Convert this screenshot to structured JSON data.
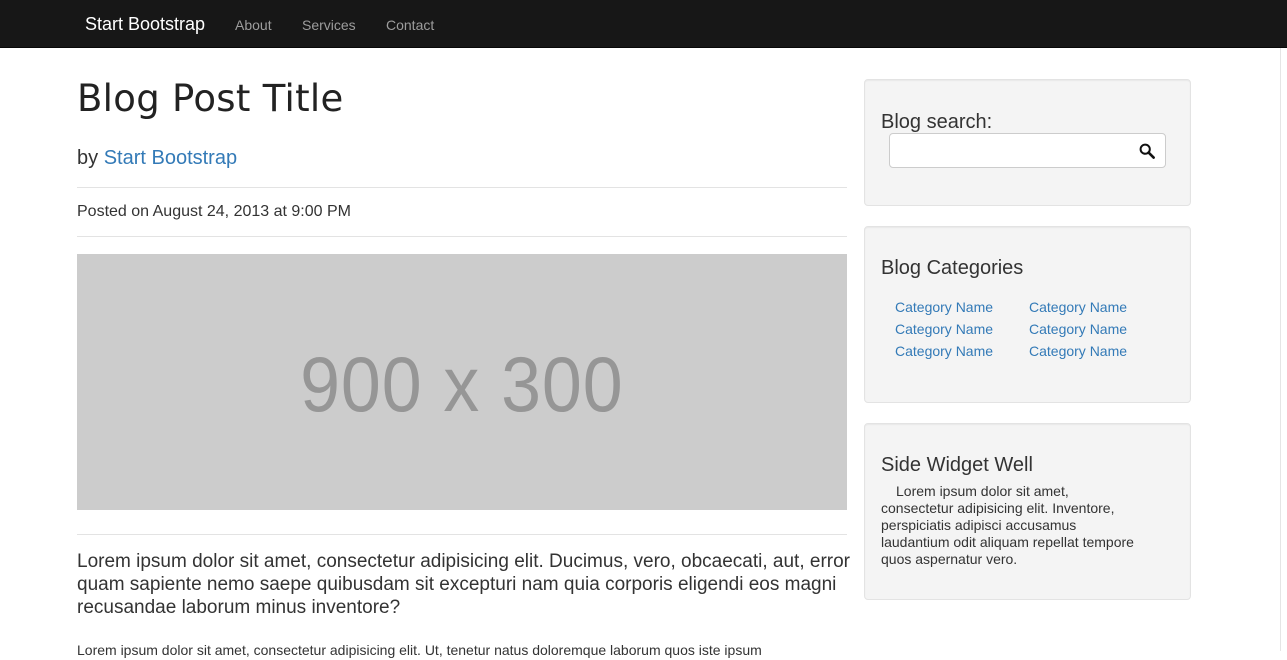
{
  "navbar": {
    "brand": "Start Bootstrap",
    "links": [
      "About",
      "Services",
      "Contact"
    ]
  },
  "post": {
    "title": "Blog Post Title",
    "by_prefix": "by ",
    "author": "Start Bootstrap",
    "posted": "Posted on August 24, 2013 at 9:00 PM",
    "image_label": "900 x 300",
    "lead": "Lorem ipsum dolor sit amet, consectetur adipisicing elit. Ducimus, vero, obcaecati, aut, error quam sapiente nemo saepe quibusdam sit excepturi nam quia corporis eligendi eos magni recusandae laborum minus inventore?",
    "body": "Lorem ipsum dolor sit amet, consectetur adipisicing elit. Ut, tenetur natus doloremque laborum quos iste ipsum"
  },
  "sidebar": {
    "search": {
      "title": "Blog search:",
      "value": "",
      "icon": "search-icon"
    },
    "categories": {
      "title": "Blog Categories",
      "col1": [
        "Category Name",
        "Category Name",
        "Category Name"
      ],
      "col2": [
        "Category Name",
        "Category Name",
        "Category Name"
      ]
    },
    "widget": {
      "title": "Side Widget Well",
      "text": "Lorem ipsum dolor sit amet, consectetur adipisicing elit. Inventore, perspiciatis adipisci accusamus laudantium odit aliquam repellat tempore quos aspernatur vero."
    }
  },
  "colors": {
    "navbar_bg": "#171717",
    "link": "#337ab7",
    "well_bg": "#f4f4f4",
    "placeholder_bg": "#cccccc"
  }
}
